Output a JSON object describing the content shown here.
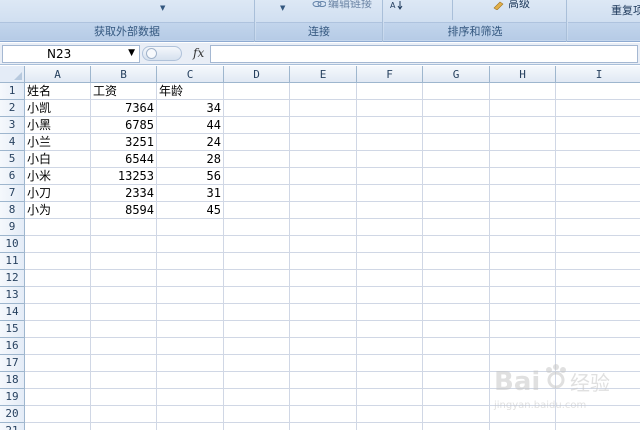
{
  "ribbon": {
    "groups": [
      {
        "label": "获取外部数据"
      },
      {
        "label": "连接",
        "top_text": "编辑链接"
      },
      {
        "label": "排序和筛选",
        "top_text": "高级"
      },
      {
        "top_text": "重复项"
      }
    ]
  },
  "formula_bar": {
    "name_box": "N23",
    "fx_label": "fx",
    "formula": ""
  },
  "grid": {
    "columns": [
      "A",
      "B",
      "C",
      "D",
      "E",
      "F",
      "G",
      "H",
      "I"
    ],
    "rows": [
      "1",
      "2",
      "3",
      "4",
      "5",
      "6",
      "7",
      "8",
      "9",
      "10",
      "11",
      "12",
      "13",
      "14",
      "15",
      "16",
      "17",
      "18",
      "19",
      "20",
      "21"
    ],
    "header_row": [
      "姓名",
      "工资",
      "年龄"
    ],
    "data": [
      {
        "name": "小凯",
        "salary": "7364",
        "age": "34"
      },
      {
        "name": "小黑",
        "salary": "6785",
        "age": "44"
      },
      {
        "name": "小兰",
        "salary": "3251",
        "age": "24"
      },
      {
        "name": "小白",
        "salary": "6544",
        "age": "28"
      },
      {
        "name": "小米",
        "salary": "13253",
        "age": "56"
      },
      {
        "name": "小刀",
        "salary": "2334",
        "age": "31"
      },
      {
        "name": "小为",
        "salary": "8594",
        "age": "45"
      }
    ]
  },
  "watermark": {
    "brand": "Bai",
    "brand2": "经验",
    "url": "jingyan.baidu.com"
  },
  "colors": {
    "ribbon_bg": "#cfdef0",
    "header_bg": "#e4ecf7",
    "gridline": "#d0d7e5"
  }
}
